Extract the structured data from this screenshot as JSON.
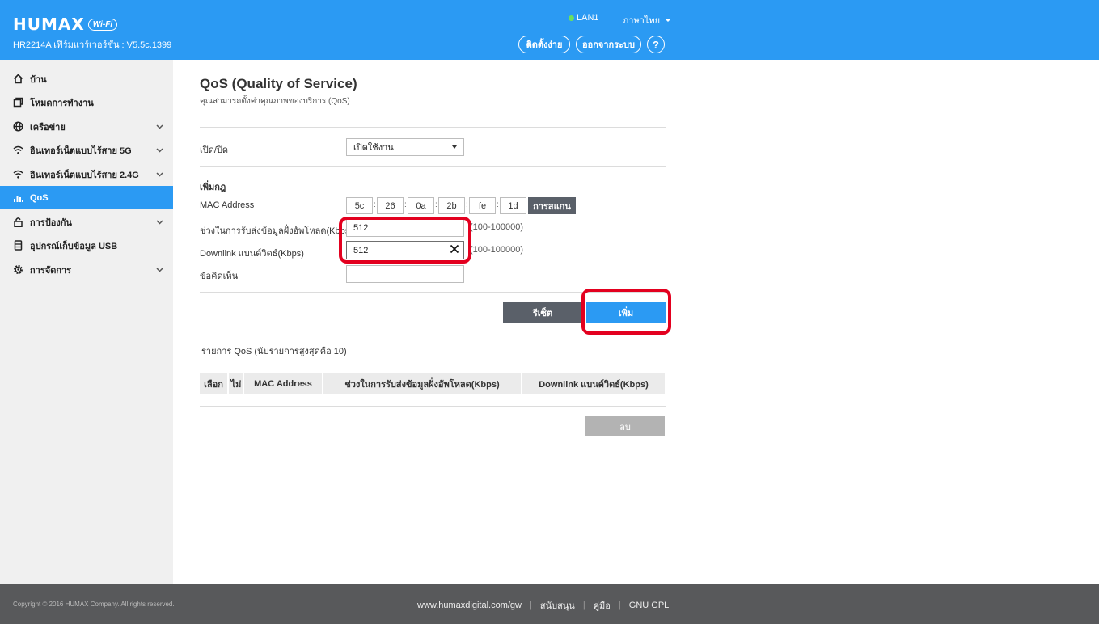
{
  "header": {
    "brand": "HUMAX",
    "wifi_badge": "Wi-Fi",
    "firmware": "HR2214A เฟิร์มแวร์เวอร์ชัน : V5.5c.1399",
    "lan_status": "LAN1",
    "language": "ภาษาไทย",
    "easy_setup": "ติดตั้งง่าย",
    "logout": "ออกจากระบบ",
    "help": "?"
  },
  "sidebar": {
    "items": [
      {
        "label": "บ้าน",
        "icon": "home-icon",
        "has_submenu": false
      },
      {
        "label": "โหมดการทำงาน",
        "icon": "mode-icon",
        "has_submenu": false
      },
      {
        "label": "เครือข่าย",
        "icon": "globe-icon",
        "has_submenu": true
      },
      {
        "label": "อินเทอร์เน็ตแบบไร้สาย 5G",
        "icon": "wifi-icon",
        "has_submenu": true
      },
      {
        "label": "อินเทอร์เน็ตแบบไร้สาย 2.4G",
        "icon": "wifi-icon",
        "has_submenu": true
      },
      {
        "label": "QoS",
        "icon": "bar-chart-icon",
        "has_submenu": false,
        "active": true
      },
      {
        "label": "การป้องกัน",
        "icon": "lock-icon",
        "has_submenu": true
      },
      {
        "label": "อุปกรณ์เก็บข้อมูล USB",
        "icon": "usb-storage-icon",
        "has_submenu": false
      },
      {
        "label": "การจัดการ",
        "icon": "gear-icon",
        "has_submenu": true
      }
    ]
  },
  "main": {
    "title": "QoS (Quality of Service)",
    "subtitle": "คุณสามารถตั้งค่าคุณภาพของบริการ (QoS)",
    "onoff_label": "เปิด/ปิด",
    "onoff_value": "เปิดใช้งาน",
    "add_rule_title": "เพิ่มกฎ",
    "mac_label": "MAC Address",
    "mac_octets": [
      "5c",
      "26",
      "0a",
      "2b",
      "fe",
      "1d"
    ],
    "scan_button": "การสแกน",
    "upload_label": "ช่วงในการรับส่งข้อมูลฝั่งอัพโหลด(Kbps)",
    "upload_value": "512",
    "upload_range": "(100-100000)",
    "downlink_label": "Downlink แบนด์วิดธ์(Kbps)",
    "downlink_value": "512",
    "downlink_range": "(100-100000)",
    "comment_label": "ข้อคิดเห็น",
    "comment_value": "",
    "reset_button": "รีเซ็ต",
    "add_button": "เพิ่ม",
    "list_title": "รายการ QoS  (นับรายการสูงสุดคือ 10)",
    "table_headers": [
      "เลือก",
      "ไม่",
      "MAC Address",
      "ช่วงในการรับส่งข้อมูลฝั่งอัพโหลด(Kbps)",
      "Downlink แบนด์วิดธ์(Kbps)"
    ],
    "delete_button": "ลบ"
  },
  "footer": {
    "copyright": "Copyright © 2016 HUMAX Company. All rights reserved.",
    "site": "www.humaxdigital.com/gw",
    "support": "สนับสนุน",
    "manual": "คู่มือ",
    "license": "GNU GPL"
  },
  "colors": {
    "header_bg": "#2b9af3",
    "sidebar_bg": "#f0f0f0",
    "active_item": "#2b9af3",
    "dark_button": "#5a6069",
    "highlight_ring": "#e3001f",
    "footer_bg": "#58595b"
  }
}
